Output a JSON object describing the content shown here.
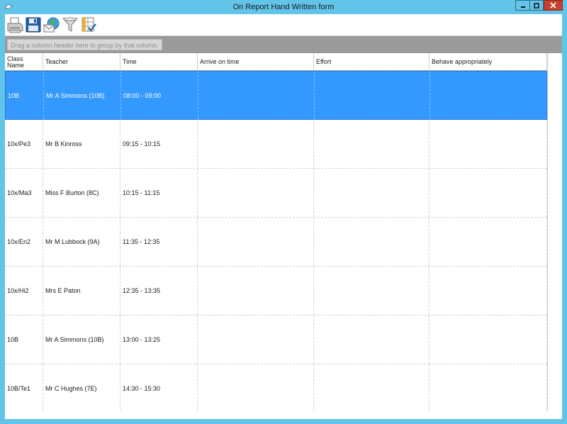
{
  "window": {
    "title": "On Report Hand Written form"
  },
  "toolbar": {
    "buttons": [
      {
        "icon": "printer-icon",
        "name": "print-button"
      },
      {
        "icon": "floppy-disk-icon",
        "name": "save-button"
      },
      {
        "icon": "email-globe-icon",
        "name": "email-button"
      },
      {
        "icon": "funnel-filter-icon",
        "name": "filter-button"
      },
      {
        "icon": "column-chooser-icon",
        "name": "column-chooser-button"
      }
    ]
  },
  "groupbar": {
    "hint": "Drag a column header here to group by that column."
  },
  "grid": {
    "columns": [
      {
        "label": "Class\nName",
        "line1": "Class",
        "line2": "Name"
      },
      {
        "label": "Teacher"
      },
      {
        "label": "Time"
      },
      {
        "label": "Arrive on time"
      },
      {
        "label": "Effort"
      },
      {
        "label": "Behave appropriately"
      }
    ],
    "rows": [
      {
        "class_name": "10B",
        "teacher": "Mr A Simmons (10B)",
        "time": "08:00 - 09:00",
        "arrive": "",
        "effort": "",
        "behave": "",
        "selected": true
      },
      {
        "class_name": "10x/Pe3",
        "teacher": "Mr B Kinross",
        "time": "09:15 - 10:15",
        "arrive": "",
        "effort": "",
        "behave": ""
      },
      {
        "class_name": "10x/Ma3",
        "teacher": "Miss F Burton (8C)",
        "time": "10:15 - 11:15",
        "arrive": "",
        "effort": "",
        "behave": ""
      },
      {
        "class_name": "10x/En2",
        "teacher": "Mr M Lubbock (9A)",
        "time": "11:35 - 12:35",
        "arrive": "",
        "effort": "",
        "behave": ""
      },
      {
        "class_name": "10x/Hi2",
        "teacher": "Mrs E Paton",
        "time": "12:35 - 13:35",
        "arrive": "",
        "effort": "",
        "behave": ""
      },
      {
        "class_name": "10B",
        "teacher": "Mr A Simmons (10B)",
        "time": "13:00 - 13:25",
        "arrive": "",
        "effort": "",
        "behave": ""
      },
      {
        "class_name": "10B/Te1",
        "teacher": "Mr C Hughes (7E)",
        "time": "14:30 - 15:30",
        "arrive": "",
        "effort": "",
        "behave": ""
      }
    ]
  },
  "colors": {
    "frame": "#62c4e8",
    "selection": "#3399ff",
    "close_button": "#c7402f",
    "groupbar": "#9a9a9a"
  }
}
